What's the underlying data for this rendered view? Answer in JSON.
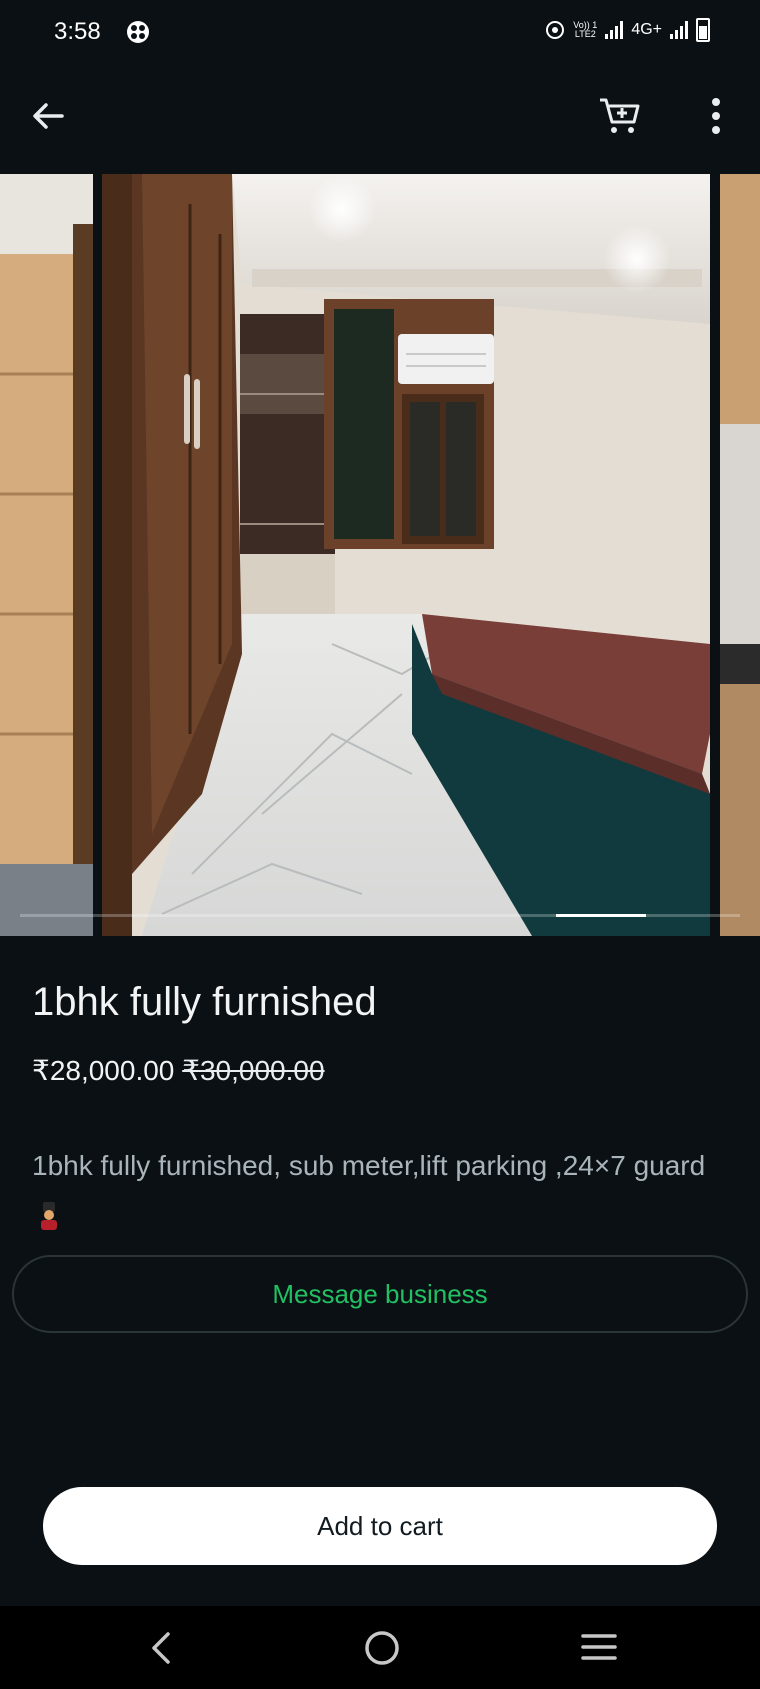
{
  "status_bar": {
    "time": "3:58",
    "volte_top": "Vo)) 1",
    "volte_bottom": "LTE2",
    "network": "4G+"
  },
  "app_bar": {
    "back_icon": "arrow-left-icon",
    "cart_icon": "shopping-cart-icon",
    "more_icon": "more-vertical-icon"
  },
  "carousel": {
    "current_index": 1,
    "count": 3,
    "progress": 0.85
  },
  "product": {
    "title": "1bhk fully furnished",
    "price": "₹28,000.00",
    "original_price": "₹30,000.00",
    "description": "1bhk fully furnished,  sub meter,lift  parking ,24×7 guard",
    "description_emoji": "guard-emoji"
  },
  "actions": {
    "message_label": "Message business",
    "add_to_cart_label": "Add to cart"
  },
  "colors": {
    "background": "#0b1014",
    "accent_green": "#21c063",
    "button_white": "#ffffff"
  },
  "nav_bar": {
    "back_icon": "nav-back-icon",
    "home_icon": "nav-home-icon",
    "recents_icon": "nav-recents-icon"
  }
}
